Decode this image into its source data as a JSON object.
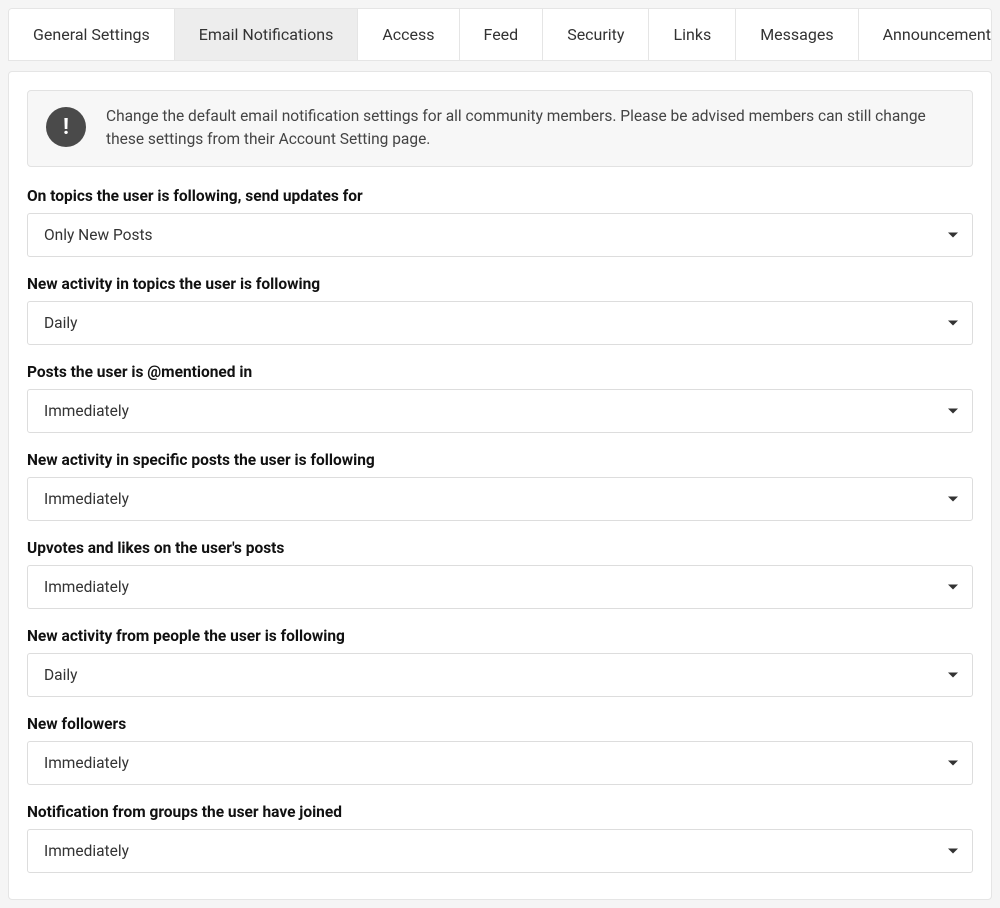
{
  "tabs": [
    {
      "label": "General Settings"
    },
    {
      "label": "Email Notifications"
    },
    {
      "label": "Access"
    },
    {
      "label": "Feed"
    },
    {
      "label": "Security"
    },
    {
      "label": "Links"
    },
    {
      "label": "Messages"
    },
    {
      "label": "Announcement"
    }
  ],
  "active_tab_index": 1,
  "banner": {
    "text": "Change the default email notification settings for all community members. Please be advised members can still change these settings from their Account Setting page."
  },
  "fields": [
    {
      "label": "On topics the user is following, send updates for",
      "value": "Only New Posts"
    },
    {
      "label": "New activity in topics the user is following",
      "value": "Daily"
    },
    {
      "label": "Posts the user is @mentioned in",
      "value": "Immediately"
    },
    {
      "label": "New activity in specific posts the user is following",
      "value": "Immediately"
    },
    {
      "label": "Upvotes and likes on the user's posts",
      "value": "Immediately"
    },
    {
      "label": "New activity from people the user is following",
      "value": "Daily"
    },
    {
      "label": "New followers",
      "value": "Immediately"
    },
    {
      "label": "Notification from groups the user have joined",
      "value": "Immediately"
    }
  ]
}
